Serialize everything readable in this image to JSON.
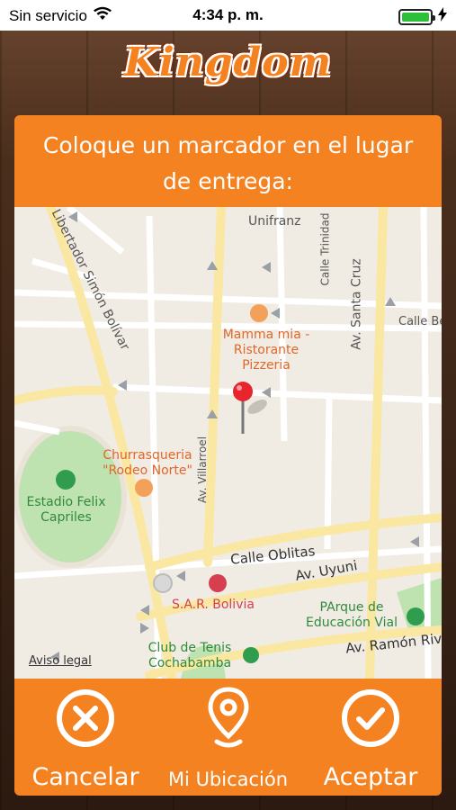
{
  "status_bar": {
    "carrier": "Sin servicio",
    "time": "4:34 p. m.",
    "battery_level": 1.0
  },
  "app": {
    "logo_text": "Kingdom",
    "brand_color": "#f58220"
  },
  "dialog": {
    "title": "Coloque un marcador en el lugar de entrega:"
  },
  "map": {
    "streets": {
      "libertador": "Libertador Simón Bolívar",
      "santa_cruz": "Av. Santa Cruz",
      "villarroel": "Av. Villarroel",
      "calle_trinidad": "Calle Trinidad",
      "calle_be": "Calle Be",
      "calle_oblitas": "Calle Oblitas",
      "av_uyuni": "Av. Uyuni",
      "av_ramon_riv": "Av. Ramón Riv"
    },
    "pois": {
      "unifranz": "Unifranz",
      "mamma_mia": "Mamma mia - Ristorante Pizzeria",
      "churrasqueria": "Churrasqueria \"Rodeo Norte\"",
      "estadio": "Estadio Felix Capriles",
      "sar_bolivia": "S.A.R. Bolivia",
      "parque": "PArque de Educación Vial",
      "club_tenis": "Club de Tenis Cochabamba"
    },
    "legal_link": "Aviso legal"
  },
  "actions": {
    "cancel": {
      "label": "Cancelar",
      "icon": "close-circle-icon"
    },
    "locate": {
      "label": "Mi Ubicación",
      "icon": "location-pin-icon"
    },
    "accept": {
      "label": "Aceptar",
      "icon": "check-circle-icon"
    }
  }
}
